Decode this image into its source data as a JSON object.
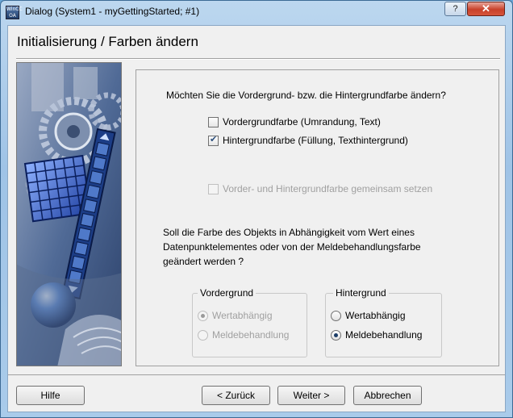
{
  "window": {
    "title": "Dialog (System1 - myGettingStarted; #1)",
    "app_icon_text": "WinCC OA",
    "help_glyph": "?",
    "close_glyph": "✕"
  },
  "page": {
    "title": "Initialisierung / Farben ändern"
  },
  "question1": "Möchten Sie die Vordergrund- bzw. die Hintergrundfarbe ändern?",
  "checkboxes": [
    {
      "label": "Vordergrundfarbe (Umrandung, Text)",
      "checked": false,
      "enabled": true
    },
    {
      "label": "Hintergrundfarbe (Füllung, Texthintergrund)",
      "checked": true,
      "enabled": true
    },
    {
      "label": "Vorder- und Hintergrundfarbe gemeinsam setzen",
      "checked": false,
      "enabled": false
    }
  ],
  "question2": {
    "line1": "Soll die Farbe des Objekts in Abhängigkeit vom Wert eines",
    "line2": "Datenpunktelementes oder von der Meldebehandlungsfarbe",
    "line3": "geändert werden ?"
  },
  "foreground_group": {
    "title": "Vordergrund",
    "enabled": false,
    "options": [
      {
        "label": "Wertabhängig",
        "selected": true
      },
      {
        "label": "Meldebehandlung",
        "selected": false
      }
    ]
  },
  "background_group": {
    "title": "Hintergrund",
    "enabled": true,
    "options": [
      {
        "label": "Wertabhängig",
        "selected": false
      },
      {
        "label": "Meldebehandlung",
        "selected": true
      }
    ]
  },
  "buttons": {
    "help": "Hilfe",
    "back": "< Zurück",
    "next": "Weiter >",
    "cancel": "Abbrechen"
  }
}
